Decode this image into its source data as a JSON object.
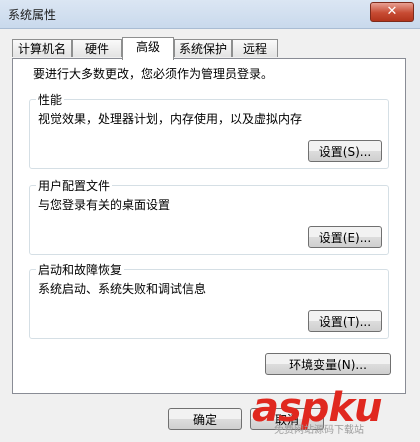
{
  "window": {
    "title": "系统属性",
    "close_glyph": "✕"
  },
  "tabs": [
    {
      "label": "计算机名"
    },
    {
      "label": "硬件"
    },
    {
      "label": "高级",
      "active": true
    },
    {
      "label": "系统保护"
    },
    {
      "label": "远程"
    }
  ],
  "panel": {
    "intro": "要进行大多数更改，您必须作为管理员登录。",
    "performance": {
      "title": "性能",
      "description": "视觉效果，处理器计划，内存使用，以及虚拟内存",
      "button": "设置(S)..."
    },
    "user_profiles": {
      "title": "用户配置文件",
      "description": "与您登录有关的桌面设置",
      "button": "设置(E)..."
    },
    "startup_recovery": {
      "title": "启动和故障恢复",
      "description": "系统启动、系统失败和调试信息",
      "button": "设置(T)..."
    },
    "env_button": "环境变量(N)..."
  },
  "footer": {
    "ok": "确定",
    "cancel": "取消"
  },
  "watermark": {
    "text": "aspku",
    "sub": "免费网站源码下载站"
  }
}
